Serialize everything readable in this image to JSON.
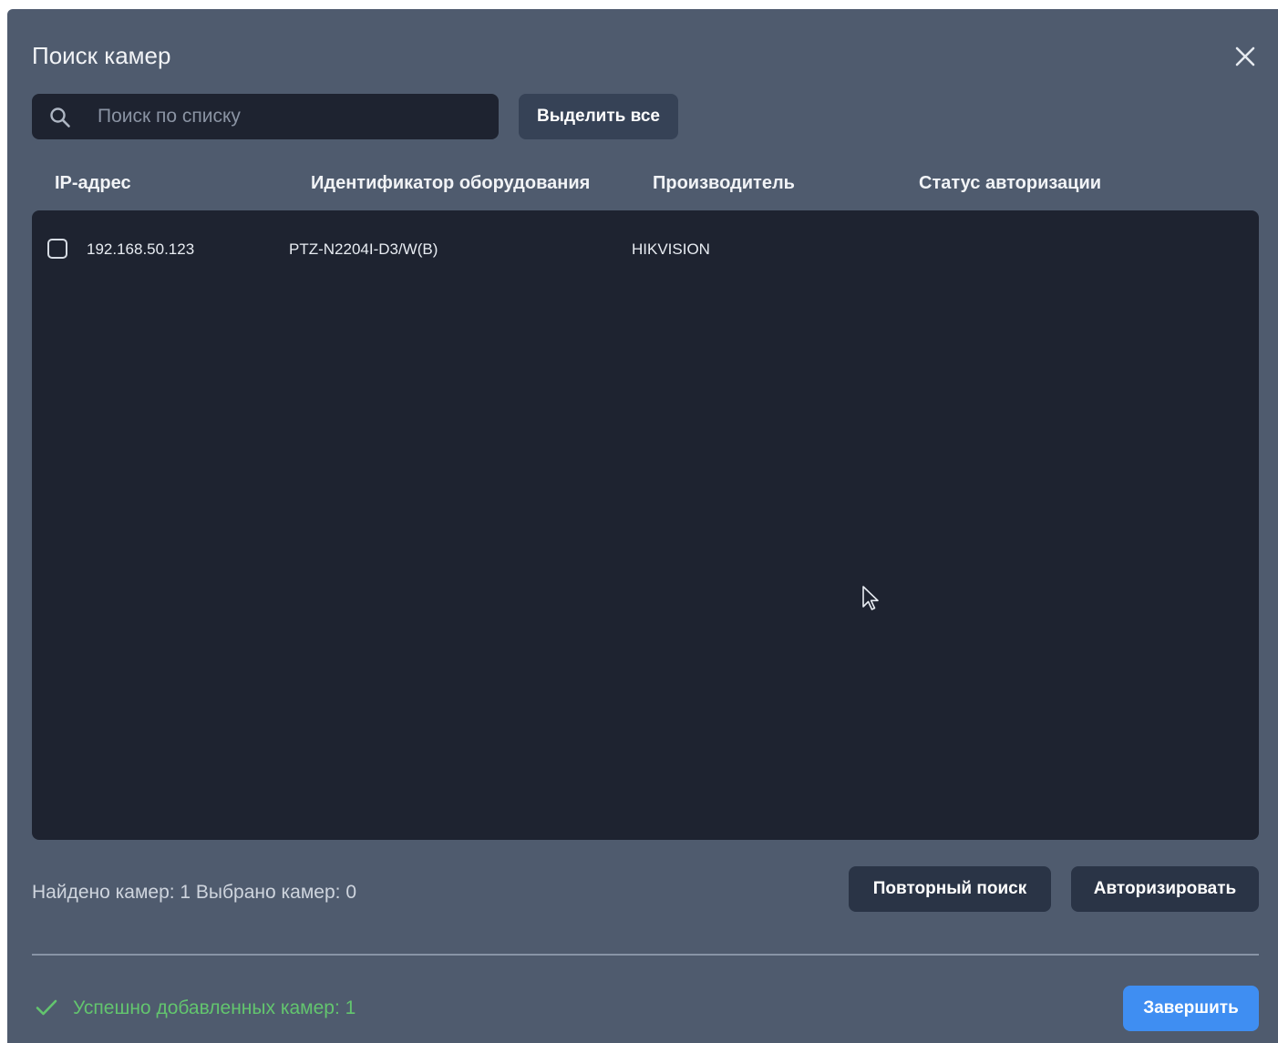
{
  "dialog": {
    "title": "Поиск камер",
    "close_icon": "close-icon"
  },
  "search": {
    "placeholder": "Поиск по списку",
    "value": "",
    "icon": "search-icon"
  },
  "toolbar": {
    "select_all_label": "Выделить все"
  },
  "table": {
    "columns": [
      "IP-адрес",
      "Идентификатор оборудования",
      "Производитель",
      "Статус авторизации"
    ],
    "rows": [
      {
        "checked": false,
        "ip": "192.168.50.123",
        "device_id": "PTZ-N2204I-D3/W(B)",
        "manufacturer": "HIKVISION",
        "auth_status": ""
      }
    ]
  },
  "footer": {
    "counts_text": "Найдено камер: 1 Выбрано камер: 0",
    "retry_label": "Повторный поиск",
    "authorize_label": "Авторизировать",
    "success_text": "Успешно добавленных камер: 1",
    "success_icon": "check-icon",
    "finish_label": "Завершить"
  },
  "colors": {
    "dialog_bg": "#4f5b6e",
    "panel_bg": "#1e2330",
    "button_bg": "#2a3446",
    "accent": "#3f8ef2",
    "success": "#63c56e"
  }
}
